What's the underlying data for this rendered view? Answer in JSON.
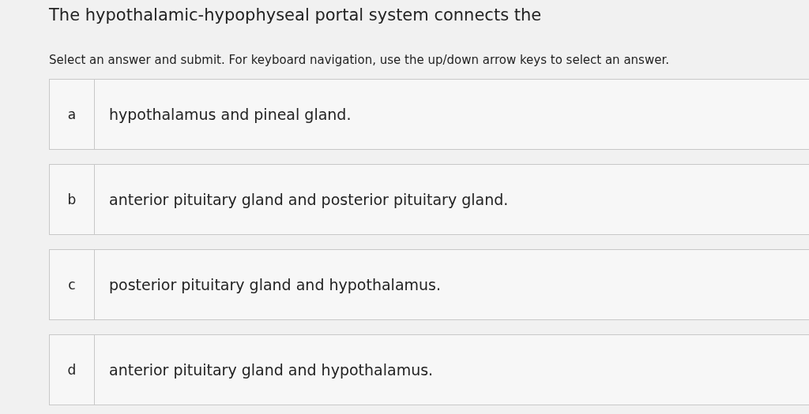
{
  "question": "The hypothalamic-hypophyseal portal system connects the",
  "instructions": "Select an answer and submit. For keyboard navigation, use the up/down arrow keys to select an answer.",
  "options": [
    {
      "letter": "a",
      "text": "hypothalamus and pineal gland.",
      "selected": false
    },
    {
      "letter": "b",
      "text": "anterior pituitary gland and posterior pituitary gland.",
      "selected": false
    },
    {
      "letter": "c",
      "text": "posterior pituitary gland and hypothalamus.",
      "selected": false
    },
    {
      "letter": "d",
      "text": "anterior pituitary gland and hypothalamus.",
      "selected": false
    }
  ]
}
